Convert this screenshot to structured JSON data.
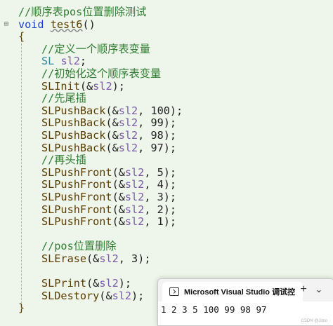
{
  "editor": {
    "lines": [
      {
        "text": "//顺序表pos位置删除测试",
        "kind": "comment"
      },
      {
        "kw": "void",
        "name": "test6",
        "tail": "()",
        "kind": "funcdef"
      },
      {
        "text": "{",
        "kind": "plain"
      },
      {
        "text": "//定义一个顺序表变量",
        "kind": "comment"
      },
      {
        "type": "SL",
        "var": "sl2",
        "tail": ";",
        "kind": "decl"
      },
      {
        "text": "//初始化这个顺序表变量",
        "kind": "comment"
      },
      {
        "text": "SLInit(&sl2);",
        "kind": "call"
      },
      {
        "text": "//先尾插",
        "kind": "comment"
      },
      {
        "text": "SLPushBack(&sl2, 100);",
        "kind": "call"
      },
      {
        "text": "SLPushBack(&sl2, 99);",
        "kind": "call"
      },
      {
        "text": "SLPushBack(&sl2, 98);",
        "kind": "call"
      },
      {
        "text": "SLPushBack(&sl2, 97);",
        "kind": "call"
      },
      {
        "text": "//再头插",
        "kind": "comment"
      },
      {
        "text": "SLPushFront(&sl2, 5);",
        "kind": "call"
      },
      {
        "text": "SLPushFront(&sl2, 4);",
        "kind": "call"
      },
      {
        "text": "SLPushFront(&sl2, 3);",
        "kind": "call"
      },
      {
        "text": "SLPushFront(&sl2, 2);",
        "kind": "call"
      },
      {
        "text": "SLPushFront(&sl2, 1);",
        "kind": "call"
      },
      {
        "text": "",
        "kind": "blank"
      },
      {
        "text": "//pos位置删除",
        "kind": "comment"
      },
      {
        "text": "SLErase(&sl2, 3);",
        "kind": "call"
      },
      {
        "text": "",
        "kind": "blank"
      },
      {
        "text": "SLPrint(&sl2);",
        "kind": "call"
      },
      {
        "text": "SLDestory(&sl2);",
        "kind": "call"
      },
      {
        "text": "}",
        "kind": "plain"
      }
    ]
  },
  "terminal": {
    "tab_title": "Microsoft Visual Studio 调试控",
    "close_glyph": "×",
    "new_tab_glyph": "+",
    "dropdown_glyph": "⌄",
    "output": "1 2 3 5 100 99 98 97"
  },
  "watermark": "CSDN @Jimo"
}
